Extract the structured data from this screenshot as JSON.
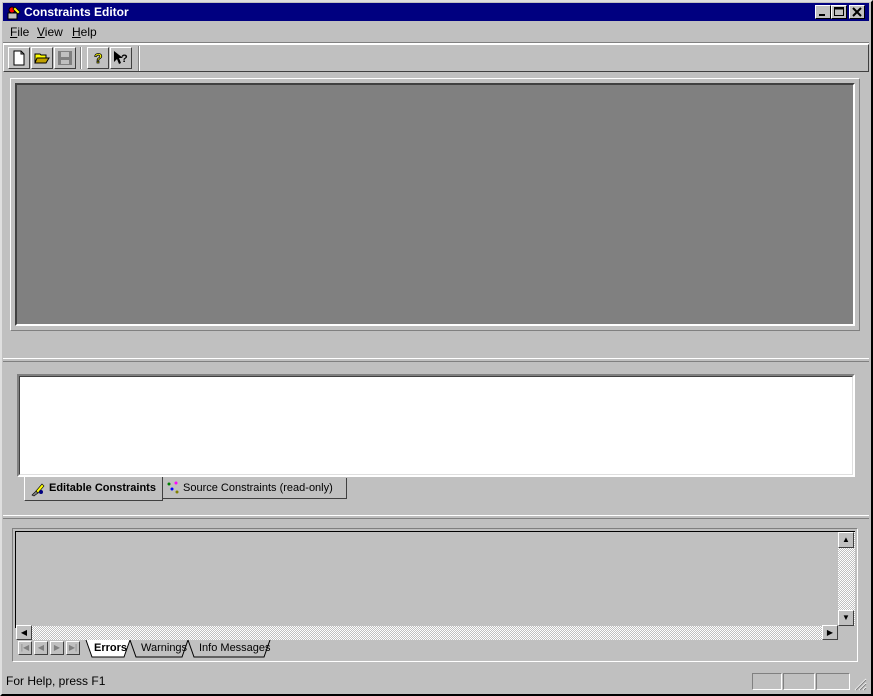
{
  "window": {
    "title": "Constraints Editor",
    "title_bar_color": "#000080",
    "caption_buttons": [
      "minimize",
      "maximize",
      "close"
    ]
  },
  "menu": {
    "items": [
      {
        "label": "File",
        "access_key": "F",
        "rest": "ile"
      },
      {
        "label": "View",
        "access_key": "V",
        "rest": "iew"
      },
      {
        "label": "Help",
        "access_key": "H",
        "rest": "elp"
      }
    ]
  },
  "toolbar": {
    "buttons": [
      {
        "name": "new-document",
        "icon": "new-document-icon"
      },
      {
        "name": "open-folder",
        "icon": "open-folder-icon"
      },
      {
        "name": "save",
        "icon": "save-disk-icon",
        "disabled": true
      },
      {
        "name": "help",
        "icon": "help-question-icon"
      },
      {
        "name": "context-help",
        "icon": "context-help-pointer-icon"
      }
    ]
  },
  "constraint_tabs": [
    {
      "label": "Editable Constraints",
      "icon": "editable-constraints-icon",
      "active": true
    },
    {
      "label": "Source Constraints (read-only)",
      "icon": "source-constraints-icon",
      "active": false
    }
  ],
  "message_tabs": [
    {
      "label": "Errors",
      "active": true
    },
    {
      "label": "Warnings",
      "active": false
    },
    {
      "label": "Info Messages",
      "active": false
    }
  ],
  "status": {
    "text": "For Help, press F1"
  },
  "colors": {
    "face": "#c0c0c0",
    "upper_panel": "#808080",
    "editor_panel": "#ffffff"
  }
}
